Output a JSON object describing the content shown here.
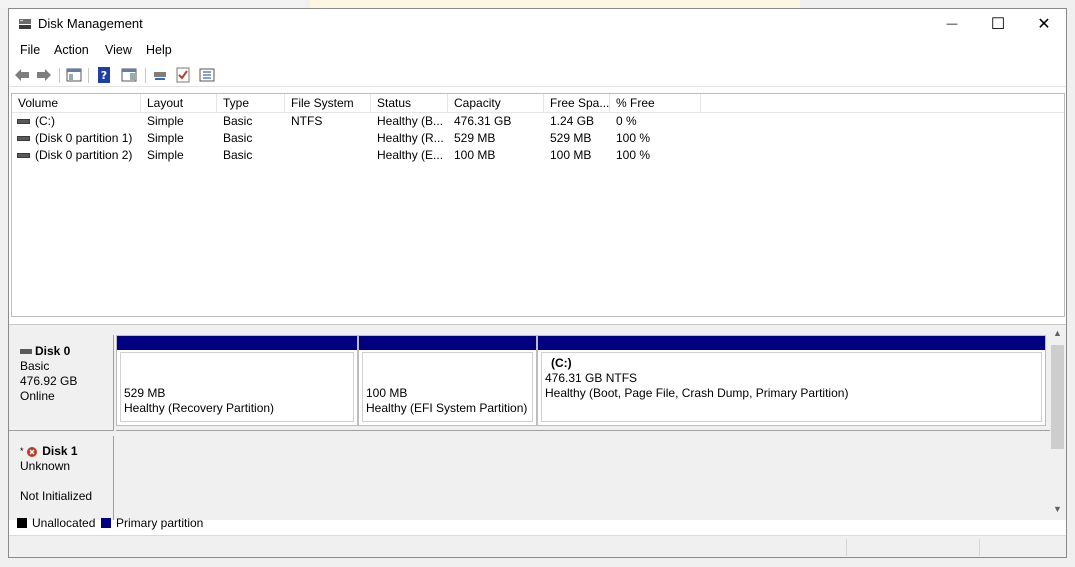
{
  "window": {
    "title": "Disk Management",
    "minimize_glyph": "—",
    "maximize_glyph": "☐",
    "close_glyph": "✕"
  },
  "menu": [
    "File",
    "Action",
    "View",
    "Help"
  ],
  "toolbar": {
    "buttons": [
      "back-arrow-icon",
      "forward-arrow-icon",
      "show-hide-console-tree-icon",
      "help-icon",
      "properties-pane-icon",
      "connect-disk-icon",
      "check-icon",
      "properties-list-icon"
    ]
  },
  "volume_list": {
    "columns": [
      "Volume",
      "Layout",
      "Type",
      "File System",
      "Status",
      "Capacity",
      "Free Spa...",
      "% Free"
    ],
    "rows": [
      [
        "(C:)",
        "Simple",
        "Basic",
        "NTFS",
        "Healthy (B...",
        "476.31 GB",
        "1.24 GB",
        "0 %"
      ],
      [
        "(Disk 0 partition 1)",
        "Simple",
        "Basic",
        "",
        "Healthy (R...",
        "529 MB",
        "529 MB",
        "100 %"
      ],
      [
        "(Disk 0 partition 2)",
        "Simple",
        "Basic",
        "",
        "Healthy (E...",
        "100 MB",
        "100 MB",
        "100 %"
      ]
    ]
  },
  "disks": [
    {
      "name": "Disk 0",
      "type": "Basic",
      "size": "476.92 GB",
      "status": "Online",
      "partitions": [
        {
          "label": "",
          "size": "529 MB",
          "status": "Healthy (Recovery Partition)"
        },
        {
          "label": "",
          "size": "100 MB",
          "status": "Healthy (EFI System Partition)"
        },
        {
          "label": "(C:)",
          "size": "476.31 GB NTFS",
          "status": "Healthy (Boot, Page File, Crash Dump, Primary Partition)"
        }
      ]
    },
    {
      "name": "Disk 1",
      "type": "Unknown",
      "status": "Not Initialized",
      "error_marker": "*"
    }
  ],
  "legend": [
    {
      "label": "Unallocated",
      "color": "#000000"
    },
    {
      "label": "Primary partition",
      "color": "#000080"
    }
  ],
  "colors": {
    "partition_bar": "#000080",
    "error_icon": "#c0392b"
  }
}
